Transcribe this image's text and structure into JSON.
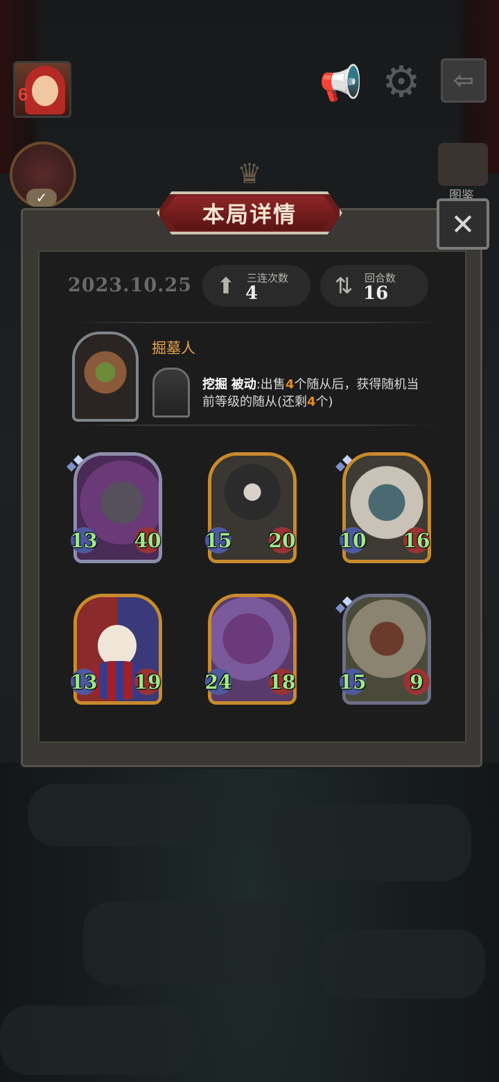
{
  "header": {
    "avatar_level": "6",
    "book_label": "图鉴"
  },
  "dialog": {
    "title": "本局详情",
    "close_label": "✕"
  },
  "summary": {
    "date": "2023.10.25",
    "triple_label": "三连次数",
    "triple_value": "4",
    "rounds_label": "回合数",
    "rounds_value": "16"
  },
  "hero": {
    "name": "掘墓人",
    "skill_name": "挖掘",
    "skill_type": "被动",
    "desc_part1": ":出售",
    "desc_num1": "4",
    "desc_part2": "个随从后，获得随机当",
    "desc_part3": "前等级的随从(还剩",
    "desc_num2": "4",
    "desc_part4": "个)"
  },
  "cards": [
    {
      "attack": "13",
      "health": "40",
      "rarity": "purple",
      "theme": "dragon"
    },
    {
      "attack": "15",
      "health": "20",
      "rarity": "gold",
      "theme": "cultist"
    },
    {
      "attack": "10",
      "health": "16",
      "rarity": "gold",
      "theme": "yeti"
    },
    {
      "attack": "13",
      "health": "19",
      "rarity": "gold",
      "theme": "clown"
    },
    {
      "attack": "24",
      "health": "18",
      "rarity": "gold",
      "theme": "demon"
    },
    {
      "attack": "15",
      "health": "9",
      "rarity": "grey",
      "theme": "owl"
    }
  ],
  "icons": {
    "horn": "megaphone-icon",
    "gear": "gear-icon",
    "exit": "exit-icon",
    "close": "close-icon"
  }
}
